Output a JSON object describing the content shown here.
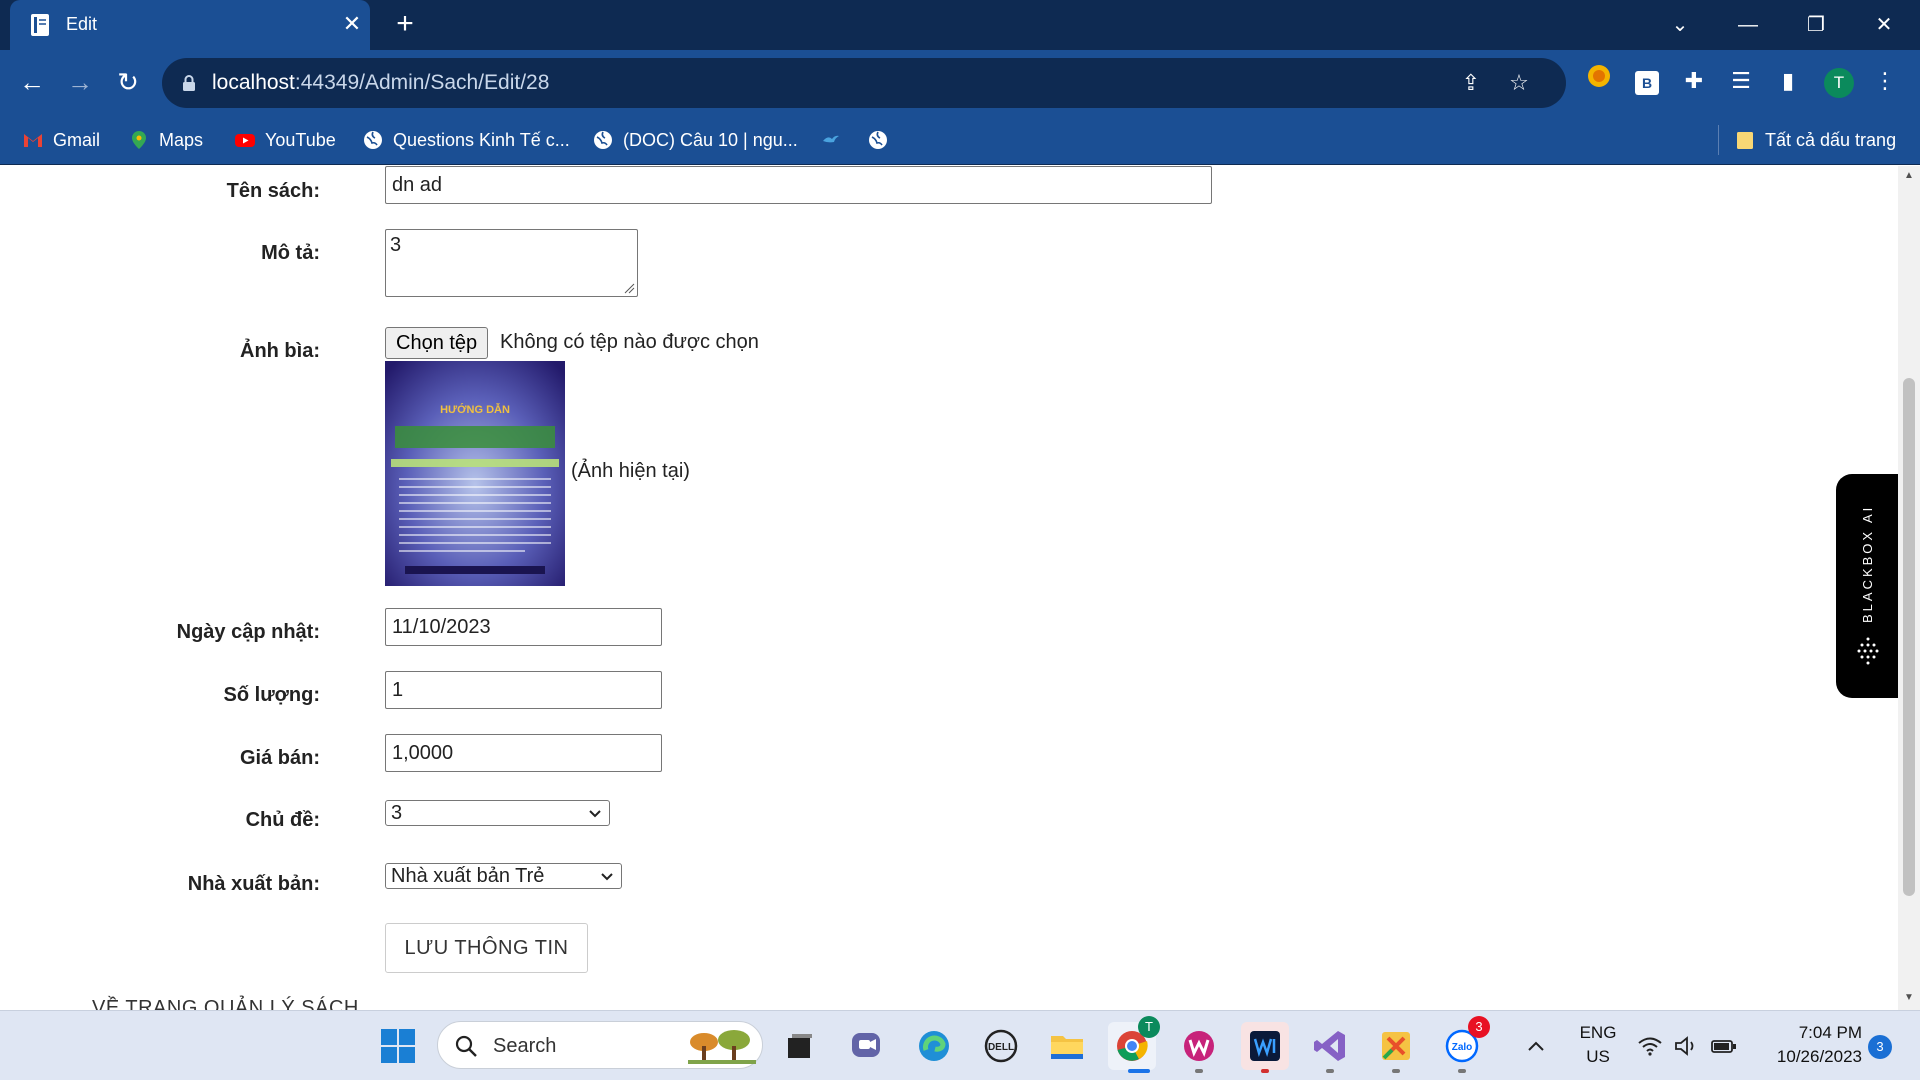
{
  "browser": {
    "tab_title": "Edit",
    "url_host": "localhost",
    "url_path": ":44349/Admin/Sach/Edit/28",
    "bookmarks": [
      "Gmail",
      "Maps",
      "YouTube",
      "Questions Kinh Tế c...",
      "(DOC) Câu 10 | ngu..."
    ],
    "all_bookmarks_label": "Tất cả dấu trang",
    "profile_initial": "T",
    "ext_b_label": "B"
  },
  "form": {
    "title_label": "Tên sách:",
    "title_value": "dn ad",
    "desc_label": "Mô tả:",
    "desc_value": "3",
    "cover_label": "Ảnh bìa:",
    "file_button": "Chọn tệp",
    "file_status": "Không có tệp nào được chọn",
    "cover_caption": "(Ảnh hiện tại)",
    "cover_title_top": "HƯỚNG DẪN",
    "date_label": "Ngày cập nhật:",
    "date_value": "11/10/2023",
    "qty_label": "Số lượng:",
    "qty_value": "1",
    "price_label": "Giá bán:",
    "price_value": "1,0000",
    "topic_label": "Chủ đề:",
    "topic_value": "3",
    "publisher_label": "Nhà xuất bản:",
    "publisher_value": "Nhà xuất bản Trẻ",
    "save_button": "LƯU THÔNG TIN",
    "back_link": "VỀ TRANG QUẢN LÝ SÁCH"
  },
  "sidebar_widget": {
    "label": "BLACKBOX AI"
  },
  "taskbar": {
    "search_placeholder": "Search",
    "lang_top": "ENG",
    "lang_bottom": "US",
    "time": "7:04 PM",
    "date": "10/26/2023",
    "notifications": "3",
    "zalo_badge": "3",
    "chrome_badge": "T"
  },
  "colors": {
    "titlebar": "#0e2a52",
    "toolbar": "#1b4f94",
    "taskbar": "#dfe6f3"
  }
}
